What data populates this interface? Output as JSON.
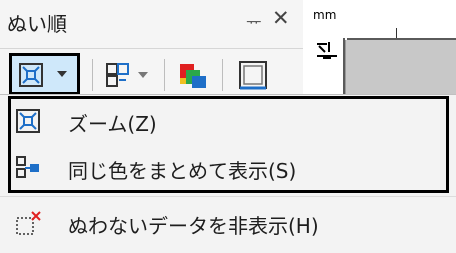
{
  "panel": {
    "title": "ぬい順",
    "pin_label": "ᅲ",
    "close_label": "✕"
  },
  "toolbar": {
    "zoom_split_icon": "zoom-fit-icon",
    "zoom_split_arrow_icon": "chevron-down-icon",
    "color_group_icon": "color-group-icon",
    "color_group_arrow_icon": "chevron-down-icon",
    "color_swatch_icon": "color-swatch-icon",
    "frame_icon": "frame-icon"
  },
  "ruler": {
    "unit": "mm"
  },
  "menu": {
    "items": [
      {
        "label": "ズーム(Z)",
        "icon": "zoom-fit-icon"
      },
      {
        "label": "同じ色をまとめて表示(S)",
        "icon": "group-same-color-icon"
      },
      {
        "label": "ぬわないデータを非表示(H)",
        "icon": "hide-unstitched-icon"
      }
    ]
  },
  "colors": {
    "selection_bg": "#cfe8fa",
    "icon_blue": "#1e6fc8",
    "icon_red": "#e02020",
    "icon_green": "#2aa84a",
    "icon_yellow": "#f0c020"
  }
}
